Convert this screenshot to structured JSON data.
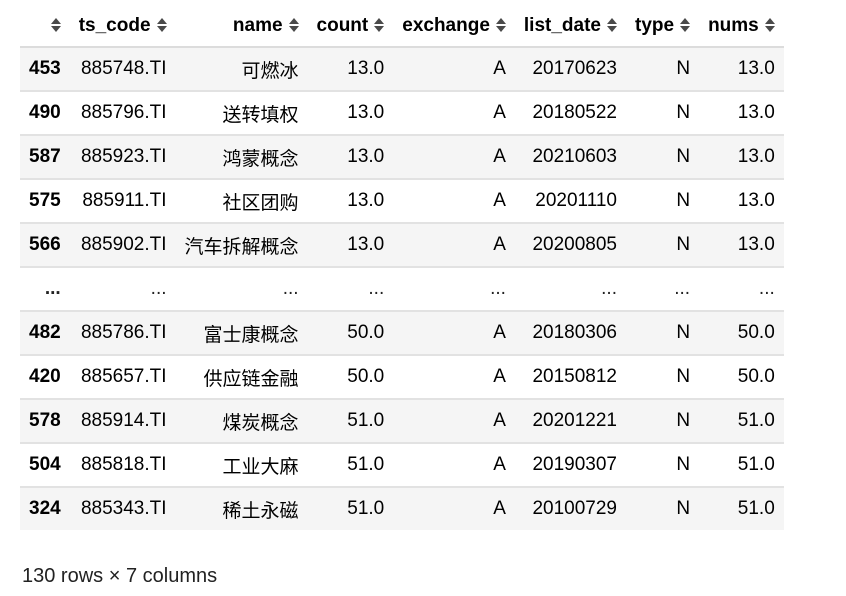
{
  "table": {
    "columns": [
      {
        "key": "index",
        "label": ""
      },
      {
        "key": "ts_code",
        "label": "ts_code"
      },
      {
        "key": "name",
        "label": "name"
      },
      {
        "key": "count",
        "label": "count"
      },
      {
        "key": "exchange",
        "label": "exchange"
      },
      {
        "key": "list_date",
        "label": "list_date"
      },
      {
        "key": "type",
        "label": "type"
      },
      {
        "key": "nums",
        "label": "nums"
      }
    ],
    "rows": [
      {
        "index": "453",
        "ts_code": "885748.TI",
        "name": "可燃冰",
        "count": "13.0",
        "exchange": "A",
        "list_date": "20170623",
        "type": "N",
        "nums": "13.0"
      },
      {
        "index": "490",
        "ts_code": "885796.TI",
        "name": "送转填权",
        "count": "13.0",
        "exchange": "A",
        "list_date": "20180522",
        "type": "N",
        "nums": "13.0"
      },
      {
        "index": "587",
        "ts_code": "885923.TI",
        "name": "鸿蒙概念",
        "count": "13.0",
        "exchange": "A",
        "list_date": "20210603",
        "type": "N",
        "nums": "13.0"
      },
      {
        "index": "575",
        "ts_code": "885911.TI",
        "name": "社区团购",
        "count": "13.0",
        "exchange": "A",
        "list_date": "20201110",
        "type": "N",
        "nums": "13.0"
      },
      {
        "index": "566",
        "ts_code": "885902.TI",
        "name": "汽车拆解概念",
        "count": "13.0",
        "exchange": "A",
        "list_date": "20200805",
        "type": "N",
        "nums": "13.0"
      },
      {
        "index": "...",
        "ts_code": "...",
        "name": "...",
        "count": "...",
        "exchange": "...",
        "list_date": "...",
        "type": "...",
        "nums": "..."
      },
      {
        "index": "482",
        "ts_code": "885786.TI",
        "name": "富士康概念",
        "count": "50.0",
        "exchange": "A",
        "list_date": "20180306",
        "type": "N",
        "nums": "50.0"
      },
      {
        "index": "420",
        "ts_code": "885657.TI",
        "name": "供应链金融",
        "count": "50.0",
        "exchange": "A",
        "list_date": "20150812",
        "type": "N",
        "nums": "50.0"
      },
      {
        "index": "578",
        "ts_code": "885914.TI",
        "name": "煤炭概念",
        "count": "51.0",
        "exchange": "A",
        "list_date": "20201221",
        "type": "N",
        "nums": "51.0"
      },
      {
        "index": "504",
        "ts_code": "885818.TI",
        "name": "工业大麻",
        "count": "51.0",
        "exchange": "A",
        "list_date": "20190307",
        "type": "N",
        "nums": "51.0"
      },
      {
        "index": "324",
        "ts_code": "885343.TI",
        "name": "稀土永磁",
        "count": "51.0",
        "exchange": "A",
        "list_date": "20100729",
        "type": "N",
        "nums": "51.0"
      }
    ]
  },
  "footer": {
    "shape_text": "130 rows × 7 columns"
  },
  "icons": {
    "sort": "sort-both-icon"
  },
  "colors": {
    "row_stripe": "#f5f5f5",
    "row_plain": "#ffffff",
    "border": "#e2e2e2"
  }
}
